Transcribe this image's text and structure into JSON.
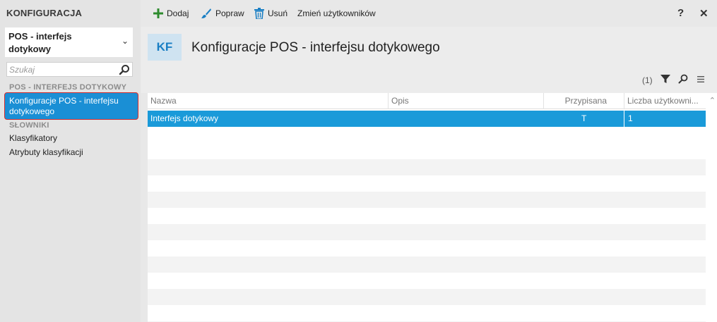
{
  "sidebar": {
    "title": "KONFIGURACJA",
    "module": "POS - interfejs dotykowy",
    "search_placeholder": "Szukaj",
    "group1": "POS - INTERFEJS DOTYKOWY",
    "active_item": "Konfiguracje POS - interfejsu dotykowego",
    "group2": "SŁOWNIKI",
    "items": [
      "Klasyfikatory",
      "Atrybuty klasyfikacji"
    ]
  },
  "toolbar": {
    "add": "Dodaj",
    "edit": "Popraw",
    "delete": "Usuń",
    "change_users": "Zmień użytkowników",
    "help": "?",
    "close": "✕"
  },
  "header": {
    "badge": "KF",
    "title": "Konfiguracje POS - interfejsu dotykowego",
    "count": "(1)"
  },
  "table": {
    "columns": [
      "Nazwa",
      "Opis",
      "Przypisana",
      "Liczba użytkowni..."
    ],
    "rows": [
      {
        "nazwa": "Interfejs dotykowy",
        "opis": "",
        "przypisana": "T",
        "liczba": "1"
      }
    ]
  },
  "colors": {
    "accent": "#1a9ad9",
    "add_icon": "#2e8b2e",
    "edit_icon": "#1a7fc4",
    "highlight_border": "#d62e2e"
  }
}
